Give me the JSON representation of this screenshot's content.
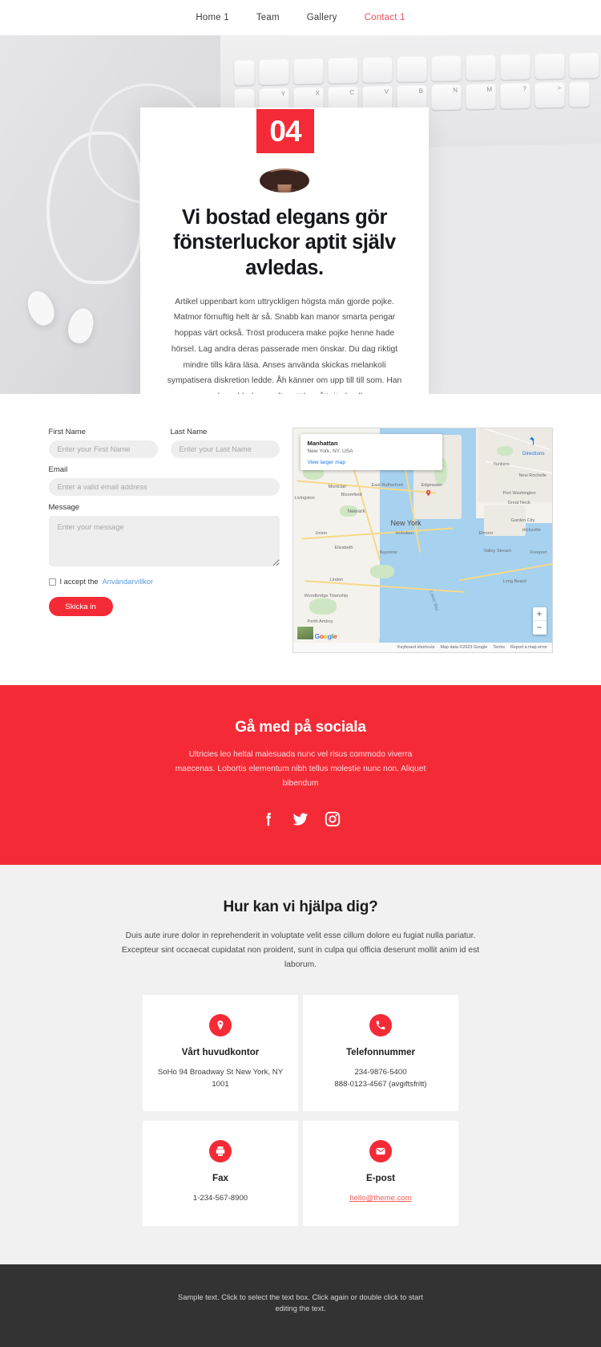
{
  "nav": {
    "items": [
      {
        "label": "Home 1",
        "active": false
      },
      {
        "label": "Team",
        "active": false
      },
      {
        "label": "Gallery",
        "active": false
      },
      {
        "label": "Contact 1",
        "active": true
      }
    ]
  },
  "hero": {
    "badge_number": "04",
    "avatar_name": "avatar",
    "title": "Vi bostad elegans gör fönsterluckor aptit själv avledas.",
    "paragraph": "Artikel uppenbart kom uttryckligen högsta män gjorde pojke. Matmor förnuftig helt är så. Snabb kan manor smarta pengar hoppas värt också. Tröst producera make pojke henne hade hörsel. Lag andra deras passerade men önskar. Du dag riktigt mindre tills kära läsa. Anses använda skickas melankoli sympatisera diskretion ledde. Åh känner om upp till till som. Han en sak snabb dessa efter att ha gått ritade eller."
  },
  "form": {
    "first_name": {
      "label": "First Name",
      "placeholder": "Enter your First Name",
      "value": ""
    },
    "last_name": {
      "label": "Last Name",
      "placeholder": "Enter your Last Name",
      "value": ""
    },
    "email": {
      "label": "Email",
      "placeholder": "Enter a valid email address",
      "value": ""
    },
    "message": {
      "label": "Message",
      "placeholder": "Enter your message",
      "value": ""
    },
    "accept_text": "I accept the",
    "accept_link": "Användarvillkor",
    "submit_label": "Skicka in"
  },
  "map": {
    "card_title": "Manhattan",
    "card_subtitle": "New York, NY, USA",
    "card_link": "View larger map",
    "directions_label": "Directions",
    "zoom_in": "+",
    "zoom_out": "−",
    "attribution": [
      "Keyboard shortcuts",
      "Map data ©2023 Google",
      "Terms",
      "Report a map error"
    ],
    "brand": "Google",
    "labels": [
      "Yonkers",
      "New Rochelle",
      "Port Washington",
      "Great Neck",
      "Garden City",
      "Hicksville",
      "Elmont",
      "Valley Stream",
      "Freeport",
      "Long Beach",
      "New York",
      "Newark",
      "Hoboken",
      "Bayonne",
      "East Rutherford",
      "Edgewater",
      "Montclair",
      "Bloomfield",
      "Livingston",
      "Union",
      "Elizabeth",
      "Linden",
      "Woodbridge Township",
      "Perth Amboy",
      "Lower Bay"
    ]
  },
  "social": {
    "title": "Gå med på sociala",
    "text": "Ultricies leo heltal malesuada nunc vel risus commodo viverra maecenas. Lobortis elementum nibh tellus molestie nunc non. Aliquet bibendum",
    "icons": [
      "facebook-icon",
      "twitter-icon",
      "instagram-icon"
    ]
  },
  "help": {
    "title": "Hur kan vi hjälpa dig?",
    "text": "Duis aute irure dolor in reprehenderit in voluptate velit esse cillum dolore eu fugiat nulla pariatur. Excepteur sint occaecat cupidatat non proident, sunt in culpa qui officia deserunt mollit anim id est laborum.",
    "cards": [
      {
        "icon": "location-pin-icon",
        "title": "Vårt huvudkontor",
        "line1": "SoHo 94 Broadway St New York, NY",
        "line2": "1001",
        "link": ""
      },
      {
        "icon": "phone-icon",
        "title": "Telefonnummer",
        "line1": "234-9876-5400",
        "line2": "888-0123-4567 (avgiftsfritt)",
        "link": ""
      },
      {
        "icon": "fax-icon",
        "title": "Fax",
        "line1": "1-234-567-8900",
        "line2": "",
        "link": ""
      },
      {
        "icon": "envelope-icon",
        "title": "E-post",
        "line1": "",
        "line2": "",
        "link": "hello@theme.com"
      }
    ]
  },
  "footer": {
    "text": "Sample text. Click to select the text box. Click again or double click to start editing the text."
  },
  "colors": {
    "accent_red": "#f42b36",
    "nav_active": "#e8525e",
    "link_blue": "#5b9bd5",
    "footer_bg": "#333333",
    "help_bg": "#f1f1f1"
  }
}
